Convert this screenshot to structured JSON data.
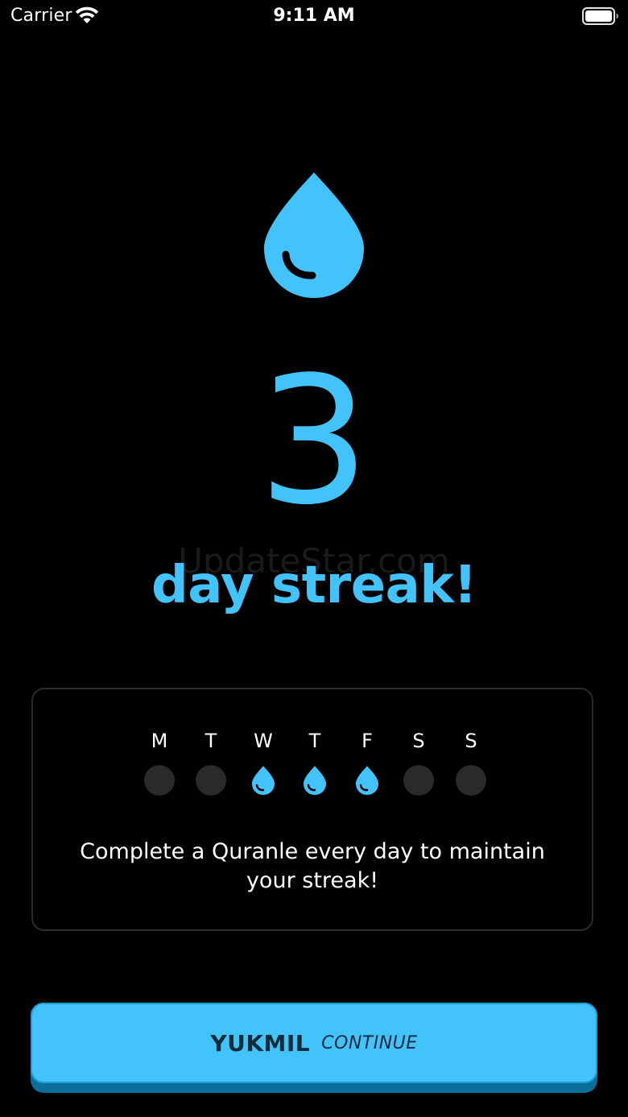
{
  "status_bar": {
    "carrier": "Carrier",
    "time": "9:11 AM",
    "icons": [
      "wifi-icon",
      "battery-icon"
    ]
  },
  "streak": {
    "icon": "water-drop-icon",
    "count": "3",
    "label": "day streak!",
    "watermark": "UpdateStar.com"
  },
  "week": {
    "days": [
      {
        "letter": "M",
        "completed": false
      },
      {
        "letter": "T",
        "completed": false
      },
      {
        "letter": "W",
        "completed": true
      },
      {
        "letter": "T",
        "completed": true
      },
      {
        "letter": "F",
        "completed": true
      },
      {
        "letter": "S",
        "completed": false
      },
      {
        "letter": "S",
        "completed": false
      }
    ],
    "message": "Complete a Quranle every day to maintain your streak!"
  },
  "continue_button": {
    "primary_label": "YUKMIL",
    "secondary_label": "CONTINUE"
  },
  "colors": {
    "background": "#000000",
    "accent": "#43c3fb",
    "button_shadow": "#0a6e9b",
    "inactive_dot": "#2a2a2a",
    "card_border": "#2b2b2b"
  }
}
